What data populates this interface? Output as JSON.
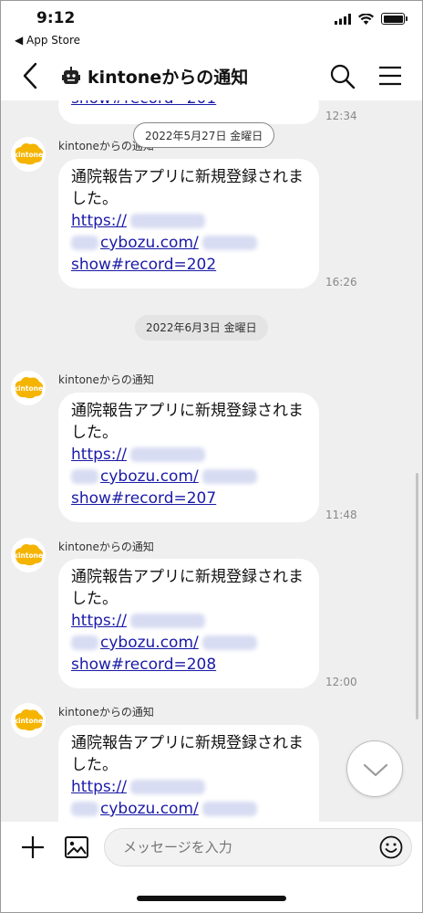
{
  "status_bar": {
    "time": "9:12",
    "back_app": "◀ App Store"
  },
  "header": {
    "title": "kintoneからの通知"
  },
  "chat": {
    "sticky_date": "2022年5月27日 金曜日",
    "first_partial": {
      "url_tail": "show#record=201",
      "time": "12:34"
    },
    "date_separator": "2022年6月3日 金曜日",
    "messages": [
      {
        "sender": "kintoneからの通知",
        "text": "通院報告アプリに新規登録されました。",
        "url_line1": "https://",
        "url_line2": "cybozu.com/",
        "url_line3": "show#record=202",
        "time": "16:26"
      },
      {
        "sender": "kintoneからの通知",
        "text": "通院報告アプリに新規登録されました。",
        "url_line1": "https://",
        "url_line2": "cybozu.com/",
        "url_line3": "show#record=207",
        "time": "11:48"
      },
      {
        "sender": "kintoneからの通知",
        "text": "通院報告アプリに新規登録されました。",
        "url_line1": "https://",
        "url_line2": "cybozu.com/",
        "url_line3": "show#record=208",
        "time": "12:00"
      },
      {
        "sender": "kintoneからの通知",
        "text": "通院報告アプリに新規登録されました。",
        "url_line1": "https://",
        "url_line2": "cybozu.com/",
        "url_line3": "",
        "time": ""
      }
    ],
    "avatar_label": "kintone"
  },
  "composer": {
    "placeholder": "メッセージを入力"
  },
  "colors": {
    "link": "#1a1aa8",
    "chat_bg": "#efefef",
    "avatar": "#f5b400"
  },
  "icons": [
    "back-chevron-icon",
    "bot-icon",
    "search-icon",
    "menu-icon",
    "chevron-down-icon",
    "plus-icon",
    "image-icon",
    "emoji-icon",
    "wifi-icon",
    "battery-icon"
  ]
}
